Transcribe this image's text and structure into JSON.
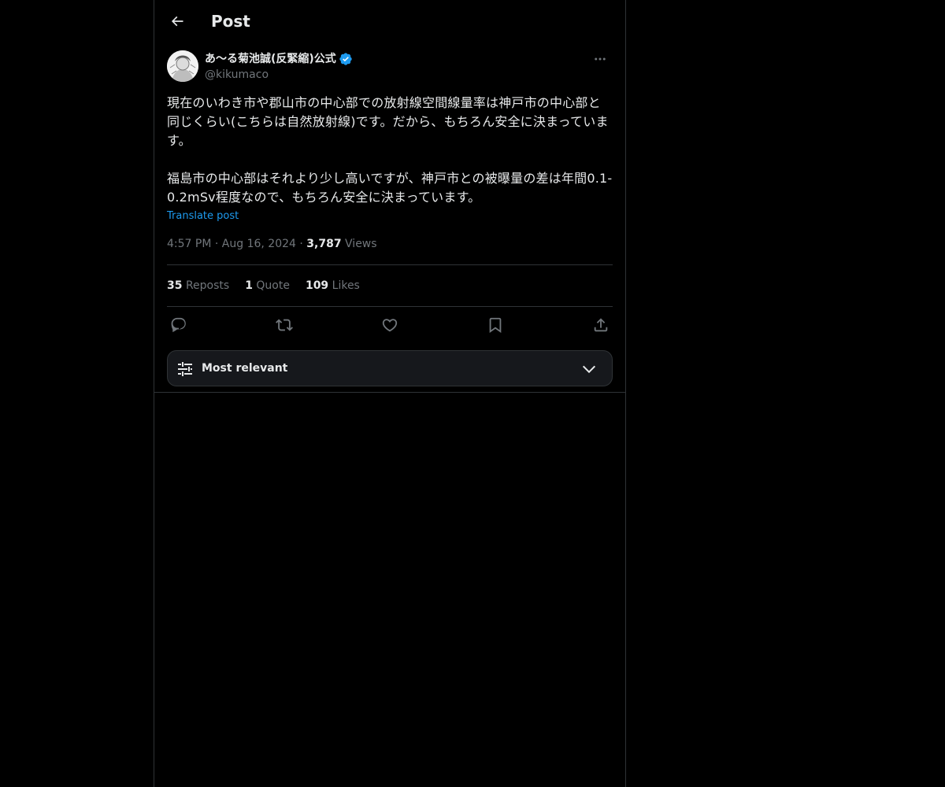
{
  "header": {
    "title": "Post",
    "back_icon": "arrow-left-icon"
  },
  "author": {
    "display_name": "あ〜る菊池誠(反緊縮)公式",
    "handle": "@kikumaco",
    "verified": true,
    "verified_color": "#1d9bf0"
  },
  "post": {
    "text": "現在のいわき市や郡山市の中心部での放射線空間線量率は神戸市の中心部と同じくらい(こちらは自然放射線)です。だから、もちろん安全に決まっています。\n\n福島市の中心部はそれより少し高いですが、神戸市との被曝量の差は年間0.1-0.2mSv程度なので、もちろん安全に決まっています。",
    "translate_label": "Translate post",
    "time": "4:57 PM",
    "date": "Aug 16, 2024",
    "separator": "·",
    "views_count": "3,787",
    "views_label": "Views"
  },
  "stats": {
    "reposts_count": "35",
    "reposts_label": "Reposts",
    "quotes_count": "1",
    "quotes_label": "Quote",
    "likes_count": "109",
    "likes_label": "Likes"
  },
  "actions": [
    "reply-icon",
    "repost-icon",
    "like-icon",
    "bookmark-icon",
    "share-icon"
  ],
  "sort": {
    "label": "Most relevant"
  },
  "colors": {
    "background": "#000000",
    "text": "#e7e9ea",
    "muted": "#71767b",
    "accent": "#1d9bf0",
    "border": "#2f3336"
  }
}
